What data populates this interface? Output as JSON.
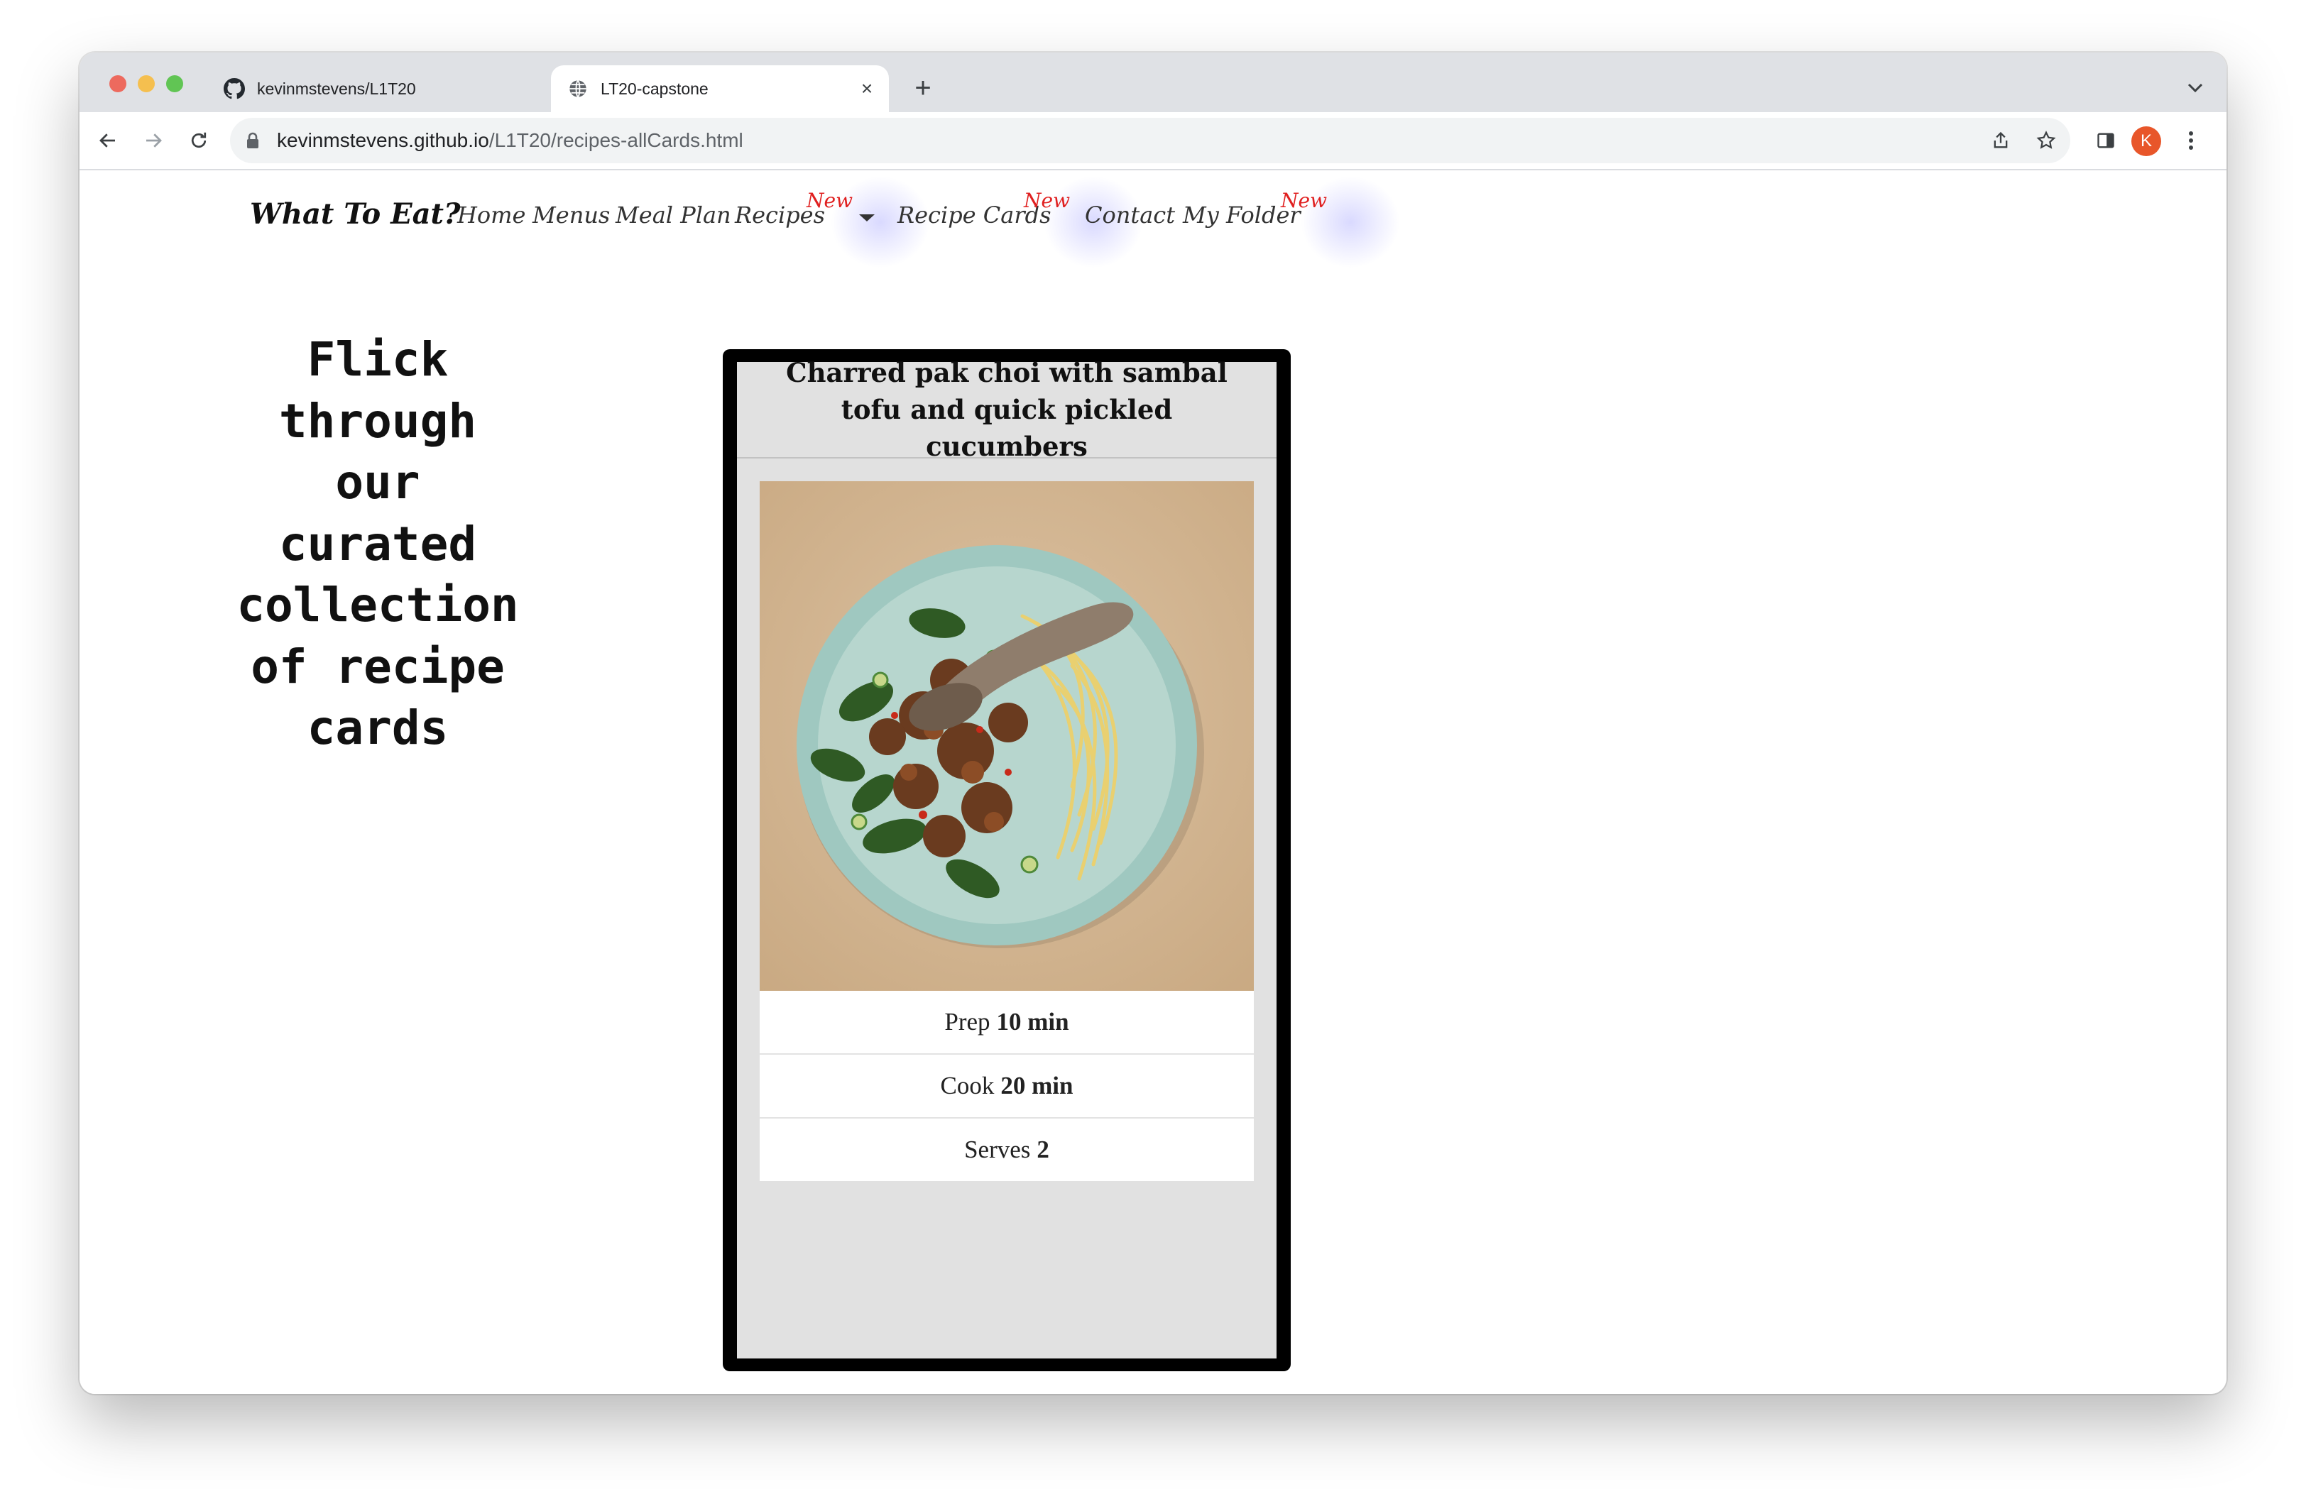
{
  "browser": {
    "tabs": [
      {
        "title": "kevinmstevens/L1T20",
        "icon": "github-icon",
        "active": false
      },
      {
        "title": "LT20-capstone",
        "icon": "globe-icon",
        "active": true
      }
    ],
    "url_host": "kevinmstevens.github.io",
    "url_path": "/L1T20/recipes-allCards.html",
    "profile_initial": "K",
    "profile_color": "#e8562a"
  },
  "site": {
    "brand": "What To Eat?",
    "nav": {
      "home": "Home",
      "menus": "Menus",
      "meal_plan": "Meal Plan",
      "recipes": "Recipes",
      "recipe_cards": "Recipe Cards",
      "contact": "Contact",
      "my_folder": "My Folder"
    },
    "new_badge": "New",
    "badge_color": "#e02020"
  },
  "main": {
    "heading": "Flick through our curated collection of recipe cards"
  },
  "card": {
    "title": "Charred pak choi with sambal tofu and quick pickled cucumbers",
    "stats": [
      {
        "label": "Prep",
        "value": "10 min"
      },
      {
        "label": "Cook",
        "value": "20 min"
      },
      {
        "label": "Serves",
        "value": "2"
      }
    ]
  }
}
